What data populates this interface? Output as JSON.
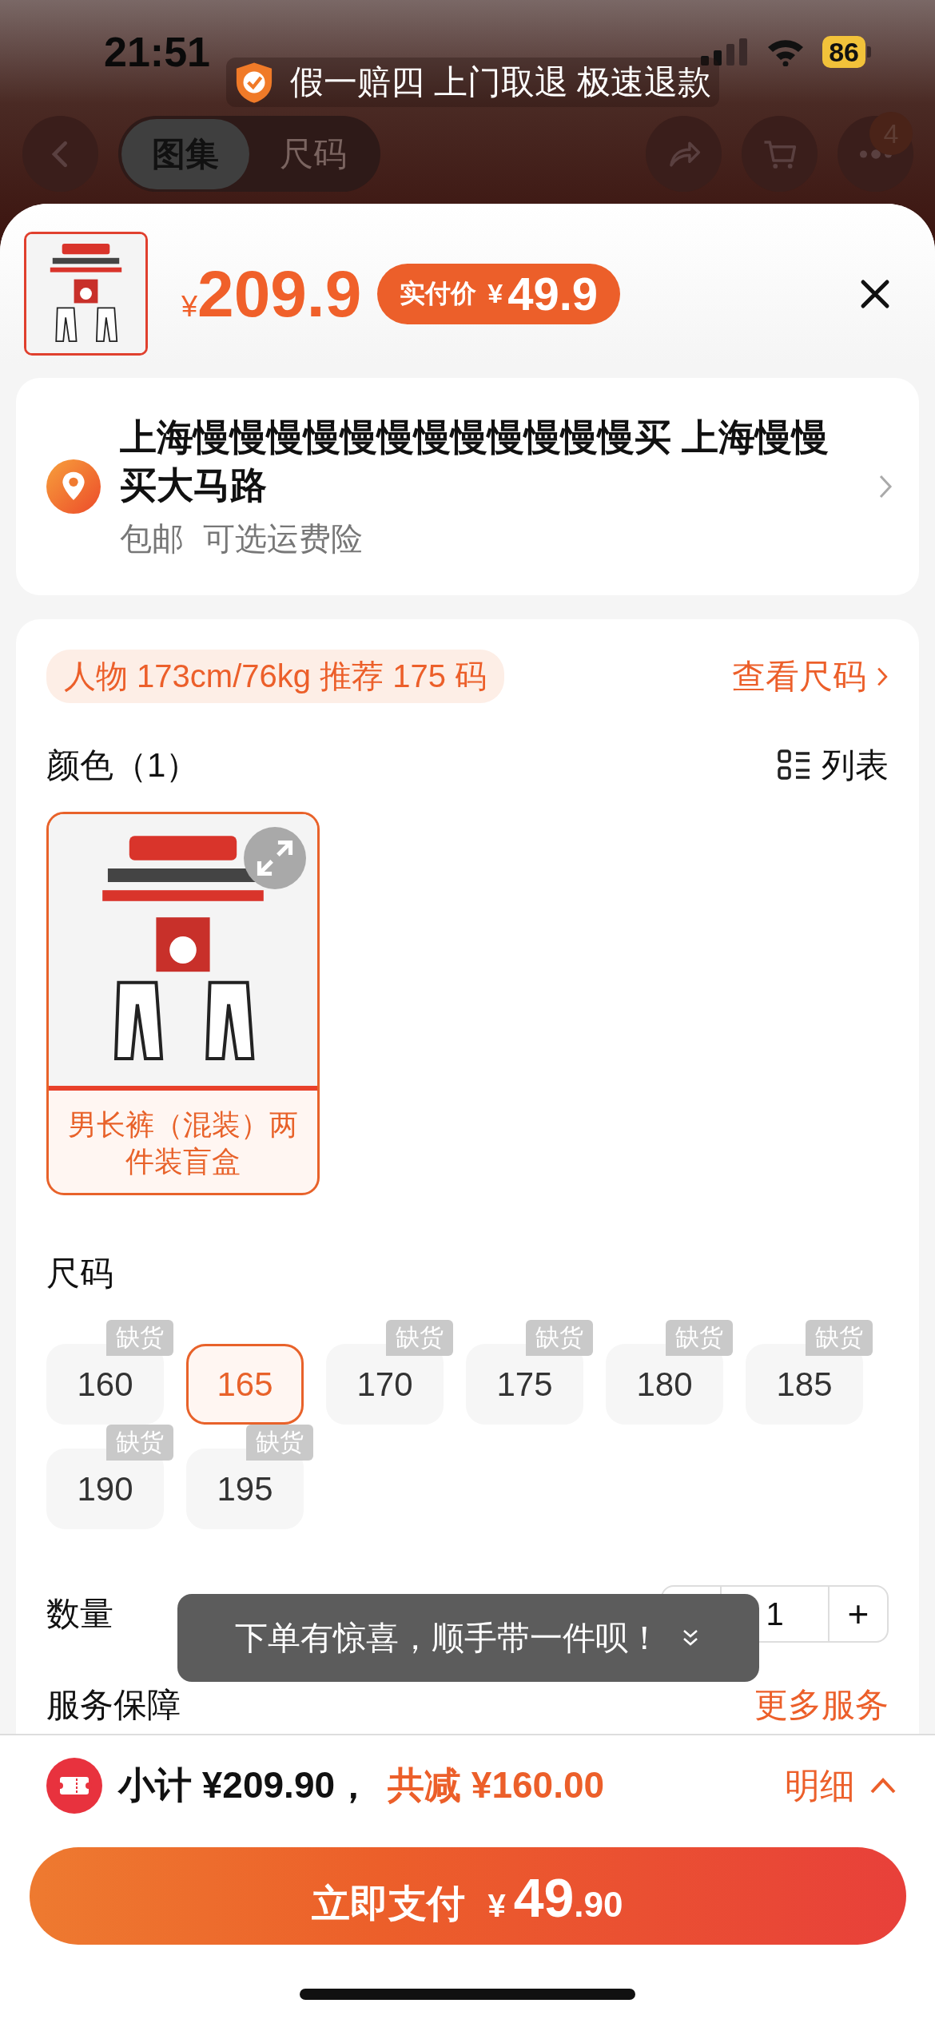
{
  "status_bar": {
    "time": "21:51",
    "battery": "86"
  },
  "header": {
    "tabs": [
      {
        "label": "图集",
        "selected": true
      },
      {
        "label": "尺码",
        "selected": false
      }
    ],
    "more_badge": "4"
  },
  "banner": {
    "text": "假一赔四 上门取退 极速退款"
  },
  "price": {
    "currency": "¥",
    "amount": "209.9",
    "final_label": "实付价",
    "final_currency": "¥",
    "final_amount": "49.9"
  },
  "address": {
    "text": "上海慢慢慢慢慢慢慢慢慢慢慢慢买 上海慢慢买大马路",
    "tags": [
      "包邮",
      "可选运费险"
    ]
  },
  "recommendation": {
    "text": "人物 173cm/76kg 推荐 175 码",
    "link": "查看尺码"
  },
  "color_section": {
    "title": "颜色（1）",
    "view_toggle": "列表",
    "options": [
      {
        "label": "男长裤（混装）两件装盲盒",
        "selected": true
      }
    ]
  },
  "size_section": {
    "title": "尺码",
    "options": [
      {
        "label": "160",
        "selected": false,
        "tag": "缺货"
      },
      {
        "label": "165",
        "selected": true
      },
      {
        "label": "170",
        "selected": false,
        "tag": "缺货"
      },
      {
        "label": "175",
        "selected": false,
        "tag": "缺货"
      },
      {
        "label": "180",
        "selected": false,
        "tag": "缺货"
      },
      {
        "label": "185",
        "selected": false,
        "tag": "缺货"
      },
      {
        "label": "190",
        "selected": false,
        "tag": "缺货"
      },
      {
        "label": "195",
        "selected": false,
        "tag": "缺货"
      }
    ]
  },
  "quantity": {
    "label": "数量",
    "value": "1",
    "plus": "+"
  },
  "service": {
    "label": "服务保障",
    "link": "更多服务"
  },
  "toast": {
    "text": "下单有惊喜，顺手带一件呗！"
  },
  "footer": {
    "subtotal": "小计 ¥209.90，",
    "discount": "共减 ¥160.00",
    "detail": "明细",
    "pay_label": "立即支付",
    "pay_currency": "¥",
    "pay_integer": "49",
    "pay_decimal": ".90"
  }
}
